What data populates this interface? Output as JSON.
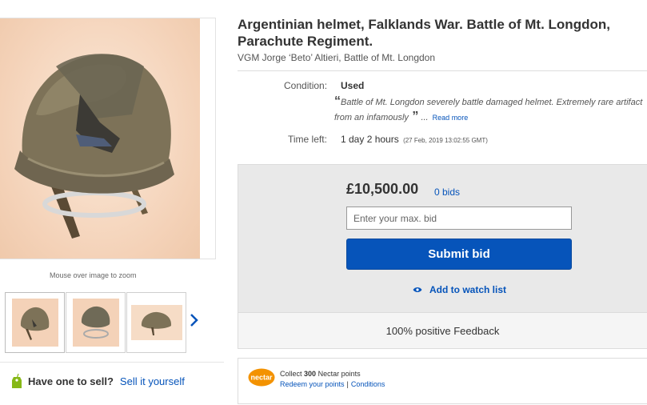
{
  "listing": {
    "title": "Argentinian helmet, Falklands War. Battle of Mt. Longdon, Parachute Regiment.",
    "subtitle": "VGM Jorge ‘Beto’ Altieri, Battle of Mt. Longdon"
  },
  "gallery": {
    "zoom_hint": "Mouse over image to zoom",
    "main_image_icon": "helmet-photo",
    "thumbnails": [
      "helmet-photo-1",
      "helmet-photo-2",
      "helmet-photo-3"
    ],
    "next_icon": "chevron-right-icon"
  },
  "details": {
    "condition_label": "Condition:",
    "condition_value": "Used",
    "description": "Battle of Mt. Longdon severely battle damaged helmet. Extremely rare artifact from an infamously",
    "read_more": "Read more",
    "time_label": "Time left:",
    "time_value": "1 day 2 hours",
    "time_date": "(27 Feb, 2019  13:02:55 GMT)"
  },
  "bidding": {
    "price": "£10,500.00",
    "bids": "0 bids",
    "input_placeholder": "Enter your max. bid",
    "submit_label": "Submit bid",
    "watch_label": "Add to watch list"
  },
  "feedback": {
    "text": "100% positive Feedback"
  },
  "nectar": {
    "logo_text": "nectar",
    "collect_prefix": "Collect",
    "points": "300",
    "collect_suffix": "Nectar points",
    "redeem_link": "Redeem your points",
    "separator": "|",
    "conditions_link": "Conditions"
  },
  "sell": {
    "question": "Have one to sell?",
    "link": "Sell it yourself"
  },
  "colors": {
    "link_blue": "#0654ba",
    "bid_panel": "#e9e9e9",
    "nectar_orange": "#f39200",
    "tag_green": "#86b817"
  }
}
